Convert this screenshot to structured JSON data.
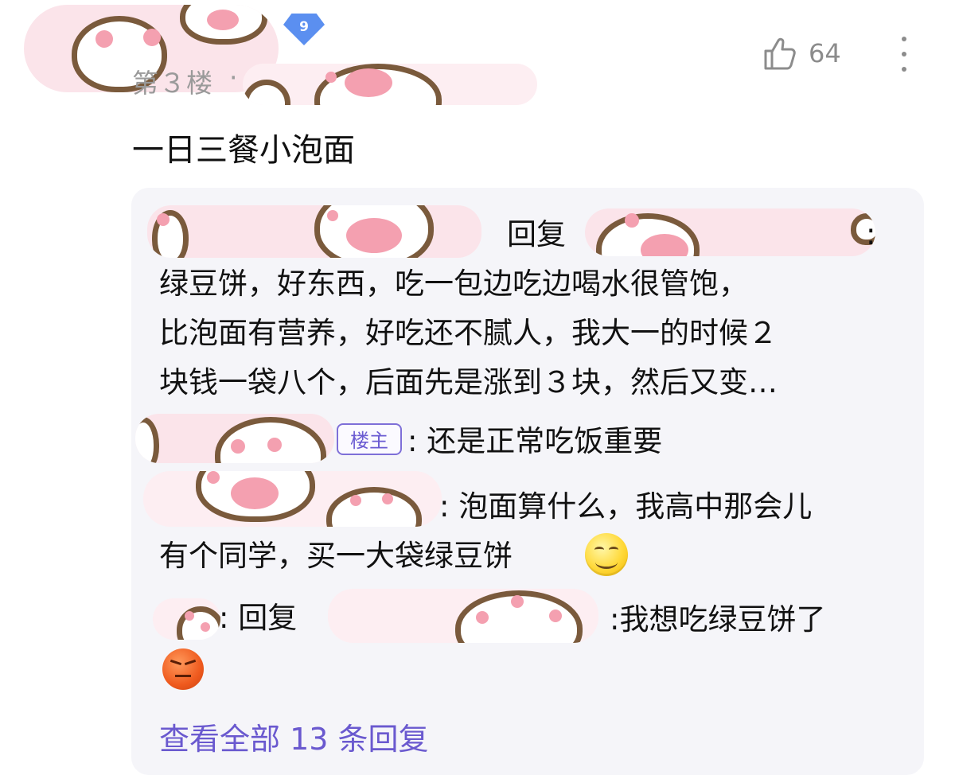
{
  "header": {
    "level": "9",
    "floor": "第３楼",
    "separator": "·",
    "like_count": "64"
  },
  "post": {
    "text": "一日三餐小泡面"
  },
  "replies": {
    "r1_reply_word": "回复",
    "r1_colon_after_target": ":",
    "r1_line1": "绿豆饼，好东西，吃一包边吃边喝水很管饱，",
    "r1_line2": "比泡面有营养，好吃还不腻人，我大一的时候２",
    "r1_line3": "块钱一袋八个，后面先是涨到３块，然后又变…",
    "r2_tag": "楼主",
    "r2_text": ": 还是正常吃饭重要",
    "r3_line1": ": 泡面算什么，我高中那会儿",
    "r3_line2": "有个同学，买一大袋绿豆饼",
    "r4_reply_word": ": 回复",
    "r4_text": ":我想吃绿豆饼了"
  },
  "footer": {
    "view_all": "查看全部 13 条回复"
  },
  "colors": {
    "accent": "#6a59cf",
    "level_badge": "#5b8ff0",
    "censor_pink": "#fbe4ea",
    "paw_brown": "#7a5a3c",
    "reply_bg": "#f5f5f9"
  },
  "icons": {
    "like": "thumbs-up-icon",
    "more": "more-vertical-icon",
    "level": "level-badge-icon",
    "emoji1": "grin-emoji-icon",
    "emoji2": "angry-emoji-icon"
  }
}
